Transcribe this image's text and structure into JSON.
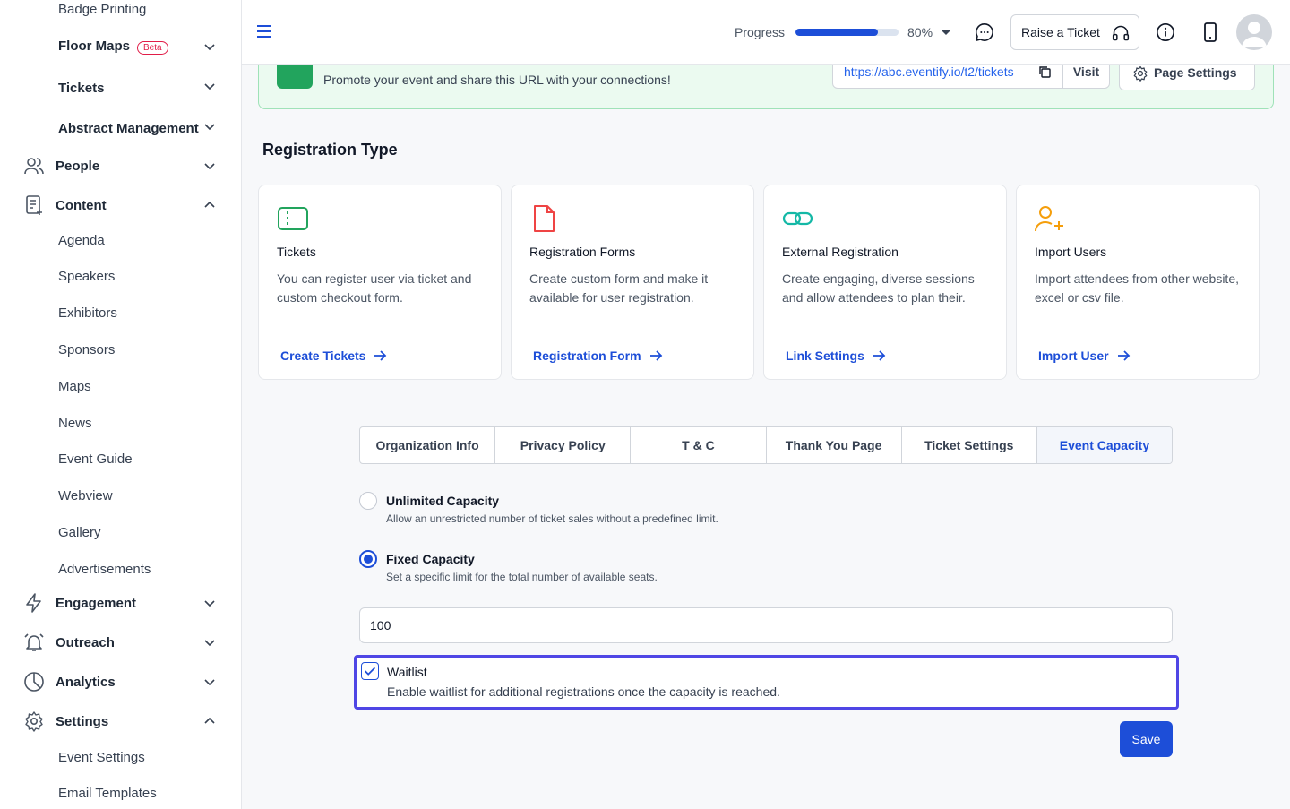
{
  "sidebar": {
    "badge_printing": "Badge Printing",
    "floor_maps": "Floor Maps",
    "beta": "Beta",
    "tickets": "Tickets",
    "abstract_management": "Abstract Management",
    "people": "People",
    "content": "Content",
    "content_items": [
      "Agenda",
      "Speakers",
      "Exhibitors",
      "Sponsors",
      "Maps",
      "News",
      "Event Guide",
      "Webview",
      "Gallery",
      "Advertisements"
    ],
    "engagement": "Engagement",
    "outreach": "Outreach",
    "analytics": "Analytics",
    "settings": "Settings",
    "settings_items": [
      "Event Settings",
      "Email Templates"
    ]
  },
  "topbar": {
    "progress_label": "Progress",
    "progress_value": "80%",
    "progress_fraction": 0.8,
    "raise_ticket": "Raise a Ticket"
  },
  "promo": {
    "text": "Promote your event and share this URL with your connections!",
    "url": "https://abc.eventify.io/t2/tickets",
    "visit": "Visit",
    "page_settings": "Page Settings"
  },
  "registration": {
    "title": "Registration Type",
    "cards": [
      {
        "title": "Tickets",
        "desc": "You can register user via ticket and custom checkout form.",
        "link": "Create Tickets"
      },
      {
        "title": "Registration Forms",
        "desc": "Create custom form and make it available for user registration.",
        "link": "Registration Form"
      },
      {
        "title": "External Registration",
        "desc": "Create engaging, diverse sessions and allow attendees to plan their.",
        "link": "Link Settings"
      },
      {
        "title": "Import Users",
        "desc": "Import attendees from other website, excel or csv file.",
        "link": "Import User"
      }
    ]
  },
  "tabs": [
    "Organization Info",
    "Privacy Policy",
    "T & C",
    "Thank You Page",
    "Ticket Settings",
    "Event Capacity"
  ],
  "capacity": {
    "unlimited_title": "Unlimited Capacity",
    "unlimited_desc": "Allow an unrestricted number of ticket sales without a predefined limit.",
    "fixed_title": "Fixed Capacity",
    "fixed_desc": "Set a specific limit for the total number of available seats.",
    "value": "100",
    "waitlist_title": "Waitlist",
    "waitlist_desc": "Enable waitlist for additional registrations once the capacity is reached.",
    "save": "Save"
  },
  "colors": {
    "accent": "#1d4ed8",
    "promo_bg": "#ebfaf0",
    "focus_ring": "#4f46e5"
  }
}
